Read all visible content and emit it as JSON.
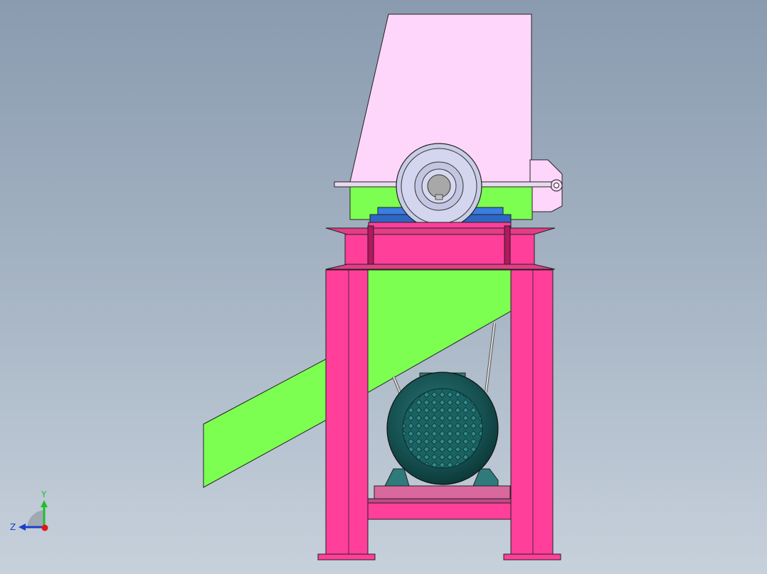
{
  "triad": {
    "y_label": "Y",
    "z_label": "Z",
    "colors": {
      "y": "#1fbf2a",
      "z": "#1a3fcc",
      "origin": "#e01818"
    }
  },
  "part_colors": {
    "hopper": "#ffd6fb",
    "chute": "#7dff52",
    "frame": "#ff3f9a",
    "flange": "#e23d86",
    "pulley": "#c9cce6",
    "bearing": "#3b7de0",
    "motor": "#1a5c5c",
    "motor_base": "#d9689f",
    "motor_feet": "#2f7a7a"
  }
}
